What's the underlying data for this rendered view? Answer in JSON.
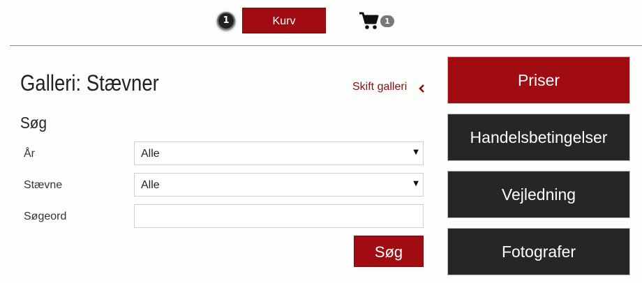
{
  "header": {
    "item_count_badge": "1",
    "cart_button_label": "Kurv",
    "cart_icon": "shopping-cart-icon",
    "cart_count": "1"
  },
  "gallery": {
    "title": "Galleri: Stævner",
    "switch_link": "Skift galleri",
    "switch_icon": "chevron-left-icon"
  },
  "search": {
    "heading": "Søg",
    "fields": [
      {
        "label": "År",
        "value": "Alle"
      },
      {
        "label": "Stævne",
        "value": "Alle"
      },
      {
        "label": "Søgeord",
        "value": ""
      }
    ],
    "submit_label": "Søg"
  },
  "sidebar": {
    "buttons": [
      {
        "label": "Priser"
      },
      {
        "label": "Handelsbetingelser"
      },
      {
        "label": "Vejledning"
      },
      {
        "label": "Fotografer"
      }
    ]
  },
  "colors": {
    "accent": "#a00c12",
    "dark": "#262626",
    "link": "#8b0d10"
  }
}
